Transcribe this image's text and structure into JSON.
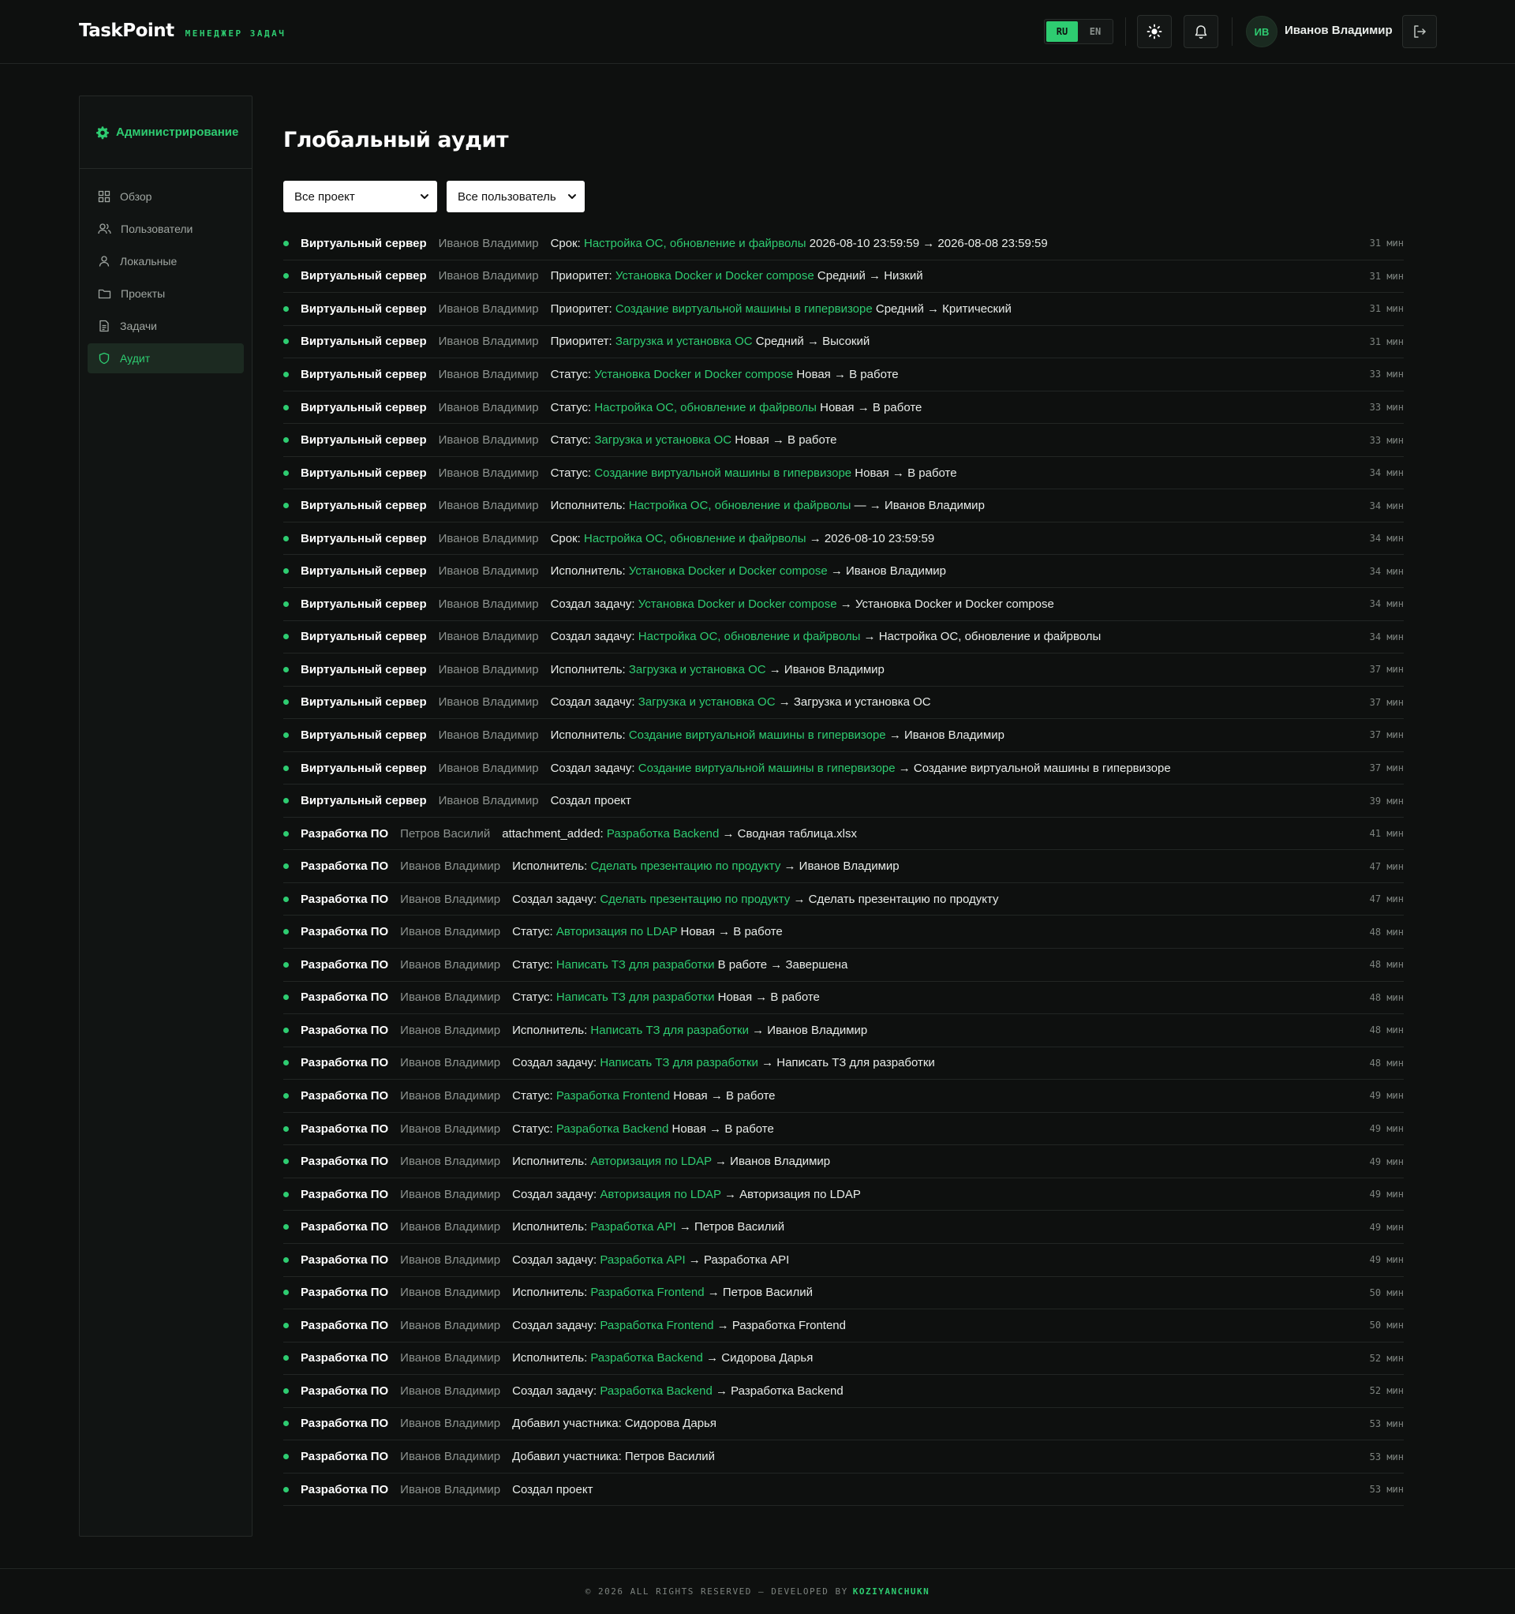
{
  "header": {
    "logo": "TaskPoint",
    "logo_sub": "МЕНЕДЖЕР ЗАДАЧ",
    "lang_ru": "RU",
    "lang_en": "EN",
    "active_lang": "RU",
    "avatar_initials": "ИВ",
    "user_name": "Иванов Владимир"
  },
  "sidebar": {
    "title": "Администрирование",
    "items": [
      {
        "label": "Обзор",
        "icon": "grid-icon"
      },
      {
        "label": "Пользователи",
        "icon": "users-icon"
      },
      {
        "label": "Локальные",
        "icon": "user-icon"
      },
      {
        "label": "Проекты",
        "icon": "folder-icon"
      },
      {
        "label": "Задачи",
        "icon": "document-icon"
      },
      {
        "label": "Аудит",
        "icon": "shield-icon",
        "active": true
      }
    ]
  },
  "main": {
    "title": "Глобальный аудит",
    "filter_project": "Все проект",
    "filter_user": "Все пользователь"
  },
  "audit": [
    {
      "project": "Виртуальный сервер",
      "user": "Иванов Владимир",
      "prefix": "Срок: ",
      "link": "Настройка ОС, обновление и файрволы",
      "suffix": " 2026-08-10 23:59:59 → 2026-08-08 23:59:59",
      "time": "31 мин"
    },
    {
      "project": "Виртуальный сервер",
      "user": "Иванов Владимир",
      "prefix": "Приоритет: ",
      "link": "Установка Docker и Docker compose",
      "suffix": " Средний → Низкий",
      "time": "31 мин"
    },
    {
      "project": "Виртуальный сервер",
      "user": "Иванов Владимир",
      "prefix": "Приоритет: ",
      "link": "Создание виртуальной машины в гипервизоре",
      "suffix": " Средний → Критический",
      "time": "31 мин"
    },
    {
      "project": "Виртуальный сервер",
      "user": "Иванов Владимир",
      "prefix": "Приоритет: ",
      "link": "Загрузка и установка ОС",
      "suffix": " Средний → Высокий",
      "time": "31 мин"
    },
    {
      "project": "Виртуальный сервер",
      "user": "Иванов Владимир",
      "prefix": "Статус: ",
      "link": "Установка Docker и Docker compose",
      "suffix": " Новая → В работе",
      "time": "33 мин"
    },
    {
      "project": "Виртуальный сервер",
      "user": "Иванов Владимир",
      "prefix": "Статус: ",
      "link": "Настройка ОС, обновление и файрволы",
      "suffix": " Новая → В работе",
      "time": "33 мин"
    },
    {
      "project": "Виртуальный сервер",
      "user": "Иванов Владимир",
      "prefix": "Статус: ",
      "link": "Загрузка и установка ОС",
      "suffix": " Новая → В работе",
      "time": "33 мин"
    },
    {
      "project": "Виртуальный сервер",
      "user": "Иванов Владимир",
      "prefix": "Статус: ",
      "link": "Создание виртуальной машины в гипервизоре",
      "suffix": " Новая → В работе",
      "time": "34 мин"
    },
    {
      "project": "Виртуальный сервер",
      "user": "Иванов Владимир",
      "prefix": "Исполнитель: ",
      "link": "Настройка ОС, обновление и файрволы",
      "suffix": " — → Иванов Владимир",
      "time": "34 мин"
    },
    {
      "project": "Виртуальный сервер",
      "user": "Иванов Владимир",
      "prefix": "Срок: ",
      "link": "Настройка ОС, обновление и файрволы",
      "suffix": " → 2026-08-10 23:59:59",
      "time": "34 мин"
    },
    {
      "project": "Виртуальный сервер",
      "user": "Иванов Владимир",
      "prefix": "Исполнитель: ",
      "link": "Установка Docker и Docker compose",
      "suffix": " → Иванов Владимир",
      "time": "34 мин"
    },
    {
      "project": "Виртуальный сервер",
      "user": "Иванов Владимир",
      "prefix": "Создал задачу: ",
      "link": "Установка Docker и Docker compose",
      "suffix": " → Установка Docker и Docker compose",
      "time": "34 мин"
    },
    {
      "project": "Виртуальный сервер",
      "user": "Иванов Владимир",
      "prefix": "Создал задачу: ",
      "link": "Настройка ОС, обновление и файрволы",
      "suffix": " → Настройка ОС, обновление и файрволы",
      "time": "34 мин"
    },
    {
      "project": "Виртуальный сервер",
      "user": "Иванов Владимир",
      "prefix": "Исполнитель: ",
      "link": "Загрузка и установка ОС",
      "suffix": " → Иванов Владимир",
      "time": "37 мин"
    },
    {
      "project": "Виртуальный сервер",
      "user": "Иванов Владимир",
      "prefix": "Создал задачу: ",
      "link": "Загрузка и установка ОС",
      "suffix": " → Загрузка и установка ОС",
      "time": "37 мин"
    },
    {
      "project": "Виртуальный сервер",
      "user": "Иванов Владимир",
      "prefix": "Исполнитель: ",
      "link": "Создание виртуальной машины в гипервизоре",
      "suffix": " → Иванов Владимир",
      "time": "37 мин"
    },
    {
      "project": "Виртуальный сервер",
      "user": "Иванов Владимир",
      "prefix": "Создал задачу: ",
      "link": "Создание виртуальной машины в гипервизоре",
      "suffix": " → Создание виртуальной машины в гипервизоре",
      "time": "37 мин"
    },
    {
      "project": "Виртуальный сервер",
      "user": "Иванов Владимир",
      "prefix": "Создал проект",
      "link": "",
      "suffix": "",
      "time": "39 мин"
    },
    {
      "project": "Разработка ПО",
      "user": "Петров Василий",
      "prefix": "attachment_added: ",
      "link": "Разработка Backend",
      "suffix": " → Сводная таблица.xlsx",
      "time": "41 мин"
    },
    {
      "project": "Разработка ПО",
      "user": "Иванов Владимир",
      "prefix": "Исполнитель: ",
      "link": "Сделать презентацию по продукту",
      "suffix": " → Иванов Владимир",
      "time": "47 мин"
    },
    {
      "project": "Разработка ПО",
      "user": "Иванов Владимир",
      "prefix": "Создал задачу: ",
      "link": "Сделать презентацию по продукту",
      "suffix": " → Сделать презентацию по продукту",
      "time": "47 мин"
    },
    {
      "project": "Разработка ПО",
      "user": "Иванов Владимир",
      "prefix": "Статус: ",
      "link": "Авторизация по LDAP",
      "suffix": " Новая → В работе",
      "time": "48 мин"
    },
    {
      "project": "Разработка ПО",
      "user": "Иванов Владимир",
      "prefix": "Статус: ",
      "link": "Написать ТЗ для разработки",
      "suffix": " В работе → Завершена",
      "time": "48 мин"
    },
    {
      "project": "Разработка ПО",
      "user": "Иванов Владимир",
      "prefix": "Статус: ",
      "link": "Написать ТЗ для разработки",
      "suffix": " Новая → В работе",
      "time": "48 мин"
    },
    {
      "project": "Разработка ПО",
      "user": "Иванов Владимир",
      "prefix": "Исполнитель: ",
      "link": "Написать ТЗ для разработки",
      "suffix": " → Иванов Владимир",
      "time": "48 мин"
    },
    {
      "project": "Разработка ПО",
      "user": "Иванов Владимир",
      "prefix": "Создал задачу: ",
      "link": "Написать ТЗ для разработки",
      "suffix": " → Написать ТЗ для разработки",
      "time": "48 мин"
    },
    {
      "project": "Разработка ПО",
      "user": "Иванов Владимир",
      "prefix": "Статус: ",
      "link": "Разработка Frontend",
      "suffix": " Новая → В работе",
      "time": "49 мин"
    },
    {
      "project": "Разработка ПО",
      "user": "Иванов Владимир",
      "prefix": "Статус: ",
      "link": "Разработка Backend",
      "suffix": " Новая → В работе",
      "time": "49 мин"
    },
    {
      "project": "Разработка ПО",
      "user": "Иванов Владимир",
      "prefix": "Исполнитель: ",
      "link": "Авторизация по LDAP",
      "suffix": " → Иванов Владимир",
      "time": "49 мин"
    },
    {
      "project": "Разработка ПО",
      "user": "Иванов Владимир",
      "prefix": "Создал задачу: ",
      "link": "Авторизация по LDAP",
      "suffix": " → Авторизация по LDAP",
      "time": "49 мин"
    },
    {
      "project": "Разработка ПО",
      "user": "Иванов Владимир",
      "prefix": "Исполнитель: ",
      "link": "Разработка API",
      "suffix": " → Петров Василий",
      "time": "49 мин"
    },
    {
      "project": "Разработка ПО",
      "user": "Иванов Владимир",
      "prefix": "Создал задачу: ",
      "link": "Разработка API",
      "suffix": " → Разработка API",
      "time": "49 мин"
    },
    {
      "project": "Разработка ПО",
      "user": "Иванов Владимир",
      "prefix": "Исполнитель: ",
      "link": "Разработка Frontend",
      "suffix": " → Петров Василий",
      "time": "50 мин"
    },
    {
      "project": "Разработка ПО",
      "user": "Иванов Владимир",
      "prefix": "Создал задачу: ",
      "link": "Разработка Frontend",
      "suffix": " → Разработка Frontend",
      "time": "50 мин"
    },
    {
      "project": "Разработка ПО",
      "user": "Иванов Владимир",
      "prefix": "Исполнитель: ",
      "link": "Разработка Backend",
      "suffix": " → Сидорова Дарья",
      "time": "52 мин"
    },
    {
      "project": "Разработка ПО",
      "user": "Иванов Владимир",
      "prefix": "Создал задачу: ",
      "link": "Разработка Backend",
      "suffix": " → Разработка Backend",
      "time": "52 мин"
    },
    {
      "project": "Разработка ПО",
      "user": "Иванов Владимир",
      "prefix": "Добавил участника: Сидорова Дарья",
      "link": "",
      "suffix": "",
      "time": "53 мин"
    },
    {
      "project": "Разработка ПО",
      "user": "Иванов Владимир",
      "prefix": "Добавил участника: Петров Василий",
      "link": "",
      "suffix": "",
      "time": "53 мин"
    },
    {
      "project": "Разработка ПО",
      "user": "Иванов Владимир",
      "prefix": "Создал проект",
      "link": "",
      "suffix": "",
      "time": "53 мин"
    }
  ],
  "footer": {
    "text": "© 2026 ALL RIGHTS RESERVED — DEVELOPED BY",
    "brand": "KOZIYANCHUKN"
  },
  "colors": {
    "accent": "#2ecc71",
    "background": "#0e100f",
    "muted": "#8d938f"
  }
}
